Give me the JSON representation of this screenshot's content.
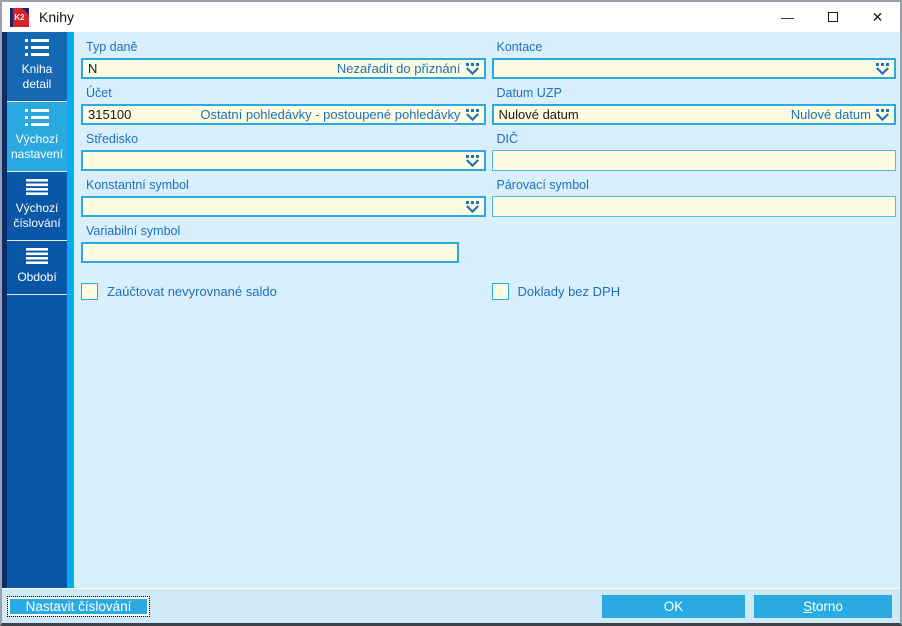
{
  "window": {
    "title": "Knihy"
  },
  "titlebar": {
    "logo_text": "K2",
    "minimize": "minimize",
    "maximize": "maximize",
    "close": "close"
  },
  "colors": {
    "accent_cyan": "#29abe2",
    "sidebar_blue": "#0a57a7",
    "sidebar_active": "#2aa9e0",
    "rail_navy": "#0b2d6b",
    "content_bg": "#d9effc",
    "field_bg": "#fdfce3",
    "label_blue": "#1d70b8",
    "logo_red": "#d6222a"
  },
  "sidebar": {
    "items": [
      {
        "label": "Kniha detail",
        "active": false
      },
      {
        "label": "Výchozí nastavení",
        "active": true
      },
      {
        "label": "Výchozí číslování",
        "active": false
      },
      {
        "label": "Období",
        "active": false
      }
    ]
  },
  "form": {
    "left": [
      {
        "label": "Typ daně",
        "value": "N",
        "display": "Nezařadit do přiznání"
      },
      {
        "label": "Účet",
        "value": "315100",
        "display": "Ostatní pohledávky - postoupené pohledávky"
      },
      {
        "label": "Středisko",
        "value": "",
        "display": ""
      },
      {
        "label": "Konstantní symbol",
        "value": "",
        "display": ""
      },
      {
        "label": "Variabilní symbol",
        "value": ""
      }
    ],
    "right": [
      {
        "label": "Kontace",
        "value": "",
        "display": ""
      },
      {
        "label": "Datum UZP",
        "value": "Nulové datum",
        "display": "Nulové datum"
      },
      {
        "label": "DIČ",
        "value": ""
      },
      {
        "label": "Párovací symbol",
        "value": ""
      }
    ],
    "checkboxes": [
      {
        "label": "Zaúčtovat nevyrovnané saldo",
        "checked": false
      },
      {
        "label": "Doklady bez DPH",
        "checked": false
      }
    ]
  },
  "footer": {
    "nastavit_label": "Nastavit číslování",
    "ok_label": "OK",
    "storno_accel": "S",
    "storno_rest": "torno"
  }
}
